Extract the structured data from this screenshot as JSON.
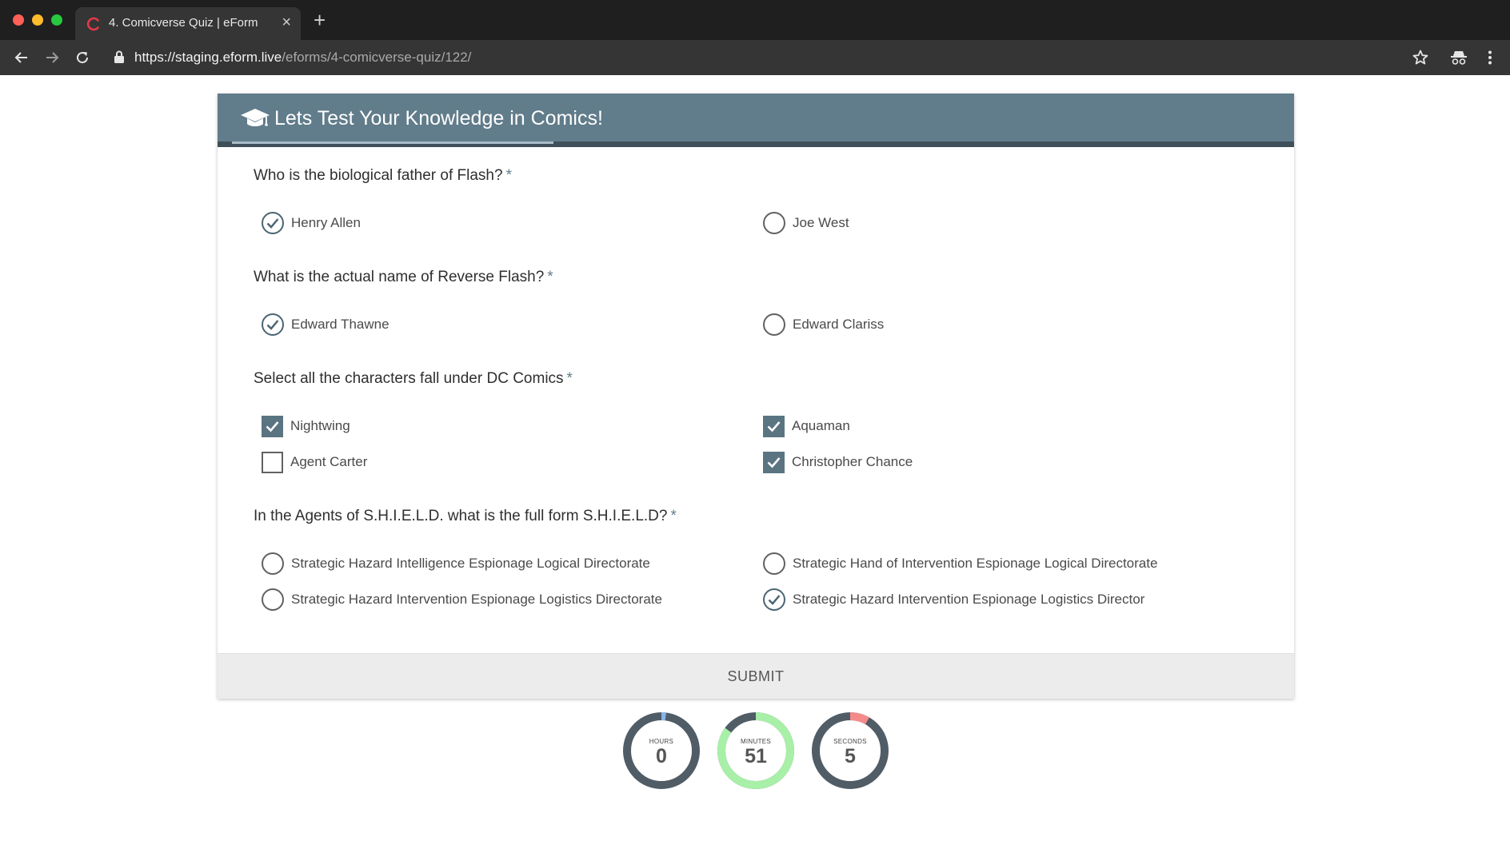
{
  "browser": {
    "tab_title": "4. Comicverse Quiz | eForm",
    "tab_close": "×",
    "new_tab": "+",
    "url_host": "https://staging.eform.live",
    "url_path": "/eforms/4-comicverse-quiz/122/"
  },
  "form": {
    "title": "Lets Test Your Knowledge in Comics!",
    "required_mark": "*",
    "questions": [
      {
        "text": "Who is the biological father of Flash?",
        "type": "radio",
        "options": [
          {
            "label": "Henry Allen",
            "checked": true
          },
          {
            "label": "Joe West",
            "checked": false
          }
        ]
      },
      {
        "text": "What is the actual name of Reverse Flash?",
        "type": "radio",
        "options": [
          {
            "label": "Edward Thawne",
            "checked": true
          },
          {
            "label": "Edward Clariss",
            "checked": false
          }
        ]
      },
      {
        "text": "Select all the characters fall under DC Comics",
        "type": "checkbox",
        "options": [
          {
            "label": "Nightwing",
            "checked": true
          },
          {
            "label": "Aquaman",
            "checked": true
          },
          {
            "label": "Agent Carter",
            "checked": false
          },
          {
            "label": "Christopher Chance",
            "checked": true
          }
        ]
      },
      {
        "text": "In the Agents of S.H.I.E.L.D. what is the full form S.H.I.E.L.D?",
        "type": "radio",
        "options": [
          {
            "label": "Strategic Hazard Intelligence Espionage Logical Directorate",
            "checked": false
          },
          {
            "label": "Strategic Hand of Intervention Espionage Logical Directorate",
            "checked": false
          },
          {
            "label": "Strategic Hazard Intervention Espionage Logistics Directorate",
            "checked": false
          },
          {
            "label": "Strategic Hazard Intervention Espionage Logistics Director",
            "checked": true
          }
        ]
      }
    ],
    "submit_label": "SUBMIT"
  },
  "timer": {
    "hours": {
      "label": "HOURS",
      "value": "0",
      "fraction": 0.02,
      "color": "#8ab4e8"
    },
    "minutes": {
      "label": "MINUTES",
      "value": "51",
      "fraction": 0.85,
      "color": "#a8f0a8"
    },
    "seconds": {
      "label": "SECONDS",
      "value": "5",
      "fraction": 0.083,
      "color": "#f58a8a"
    }
  },
  "colors": {
    "header": "#617c8a",
    "accent": "#5a7482",
    "timer_track": "#505c66"
  }
}
